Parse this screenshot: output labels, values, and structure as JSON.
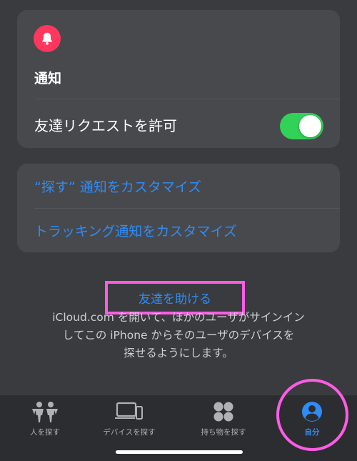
{
  "notifications_card": {
    "title": "通知",
    "toggle_label": "友達リクエストを許可",
    "toggle_on": true
  },
  "customize_card": {
    "items": [
      {
        "label": "“探す” 通知をカスタマイズ"
      },
      {
        "label": "トラッキング通知をカスタマイズ"
      }
    ]
  },
  "help": {
    "button_label": "友達を助ける",
    "description": "iCloud.com を開いて、ほかのユーザがサインイン\nしてこの iPhone からそのユーザのデバイスを\n探せるようにします。"
  },
  "tabbar": {
    "tabs": [
      {
        "label": "人を探す",
        "icon": "people-icon",
        "active": false
      },
      {
        "label": "デバイスを探す",
        "icon": "devices-icon",
        "active": false
      },
      {
        "label": "持ち物を探す",
        "icon": "items-icon",
        "active": false
      },
      {
        "label": "自分",
        "icon": "person-icon",
        "active": true
      }
    ]
  },
  "colors": {
    "background": "#3a3b3e",
    "card": "#48494d",
    "accent_blue": "#2f8cf5",
    "toggle_green": "#32d158",
    "bell_red": "#ff375f",
    "highlight_pink": "#ff5ce6"
  }
}
